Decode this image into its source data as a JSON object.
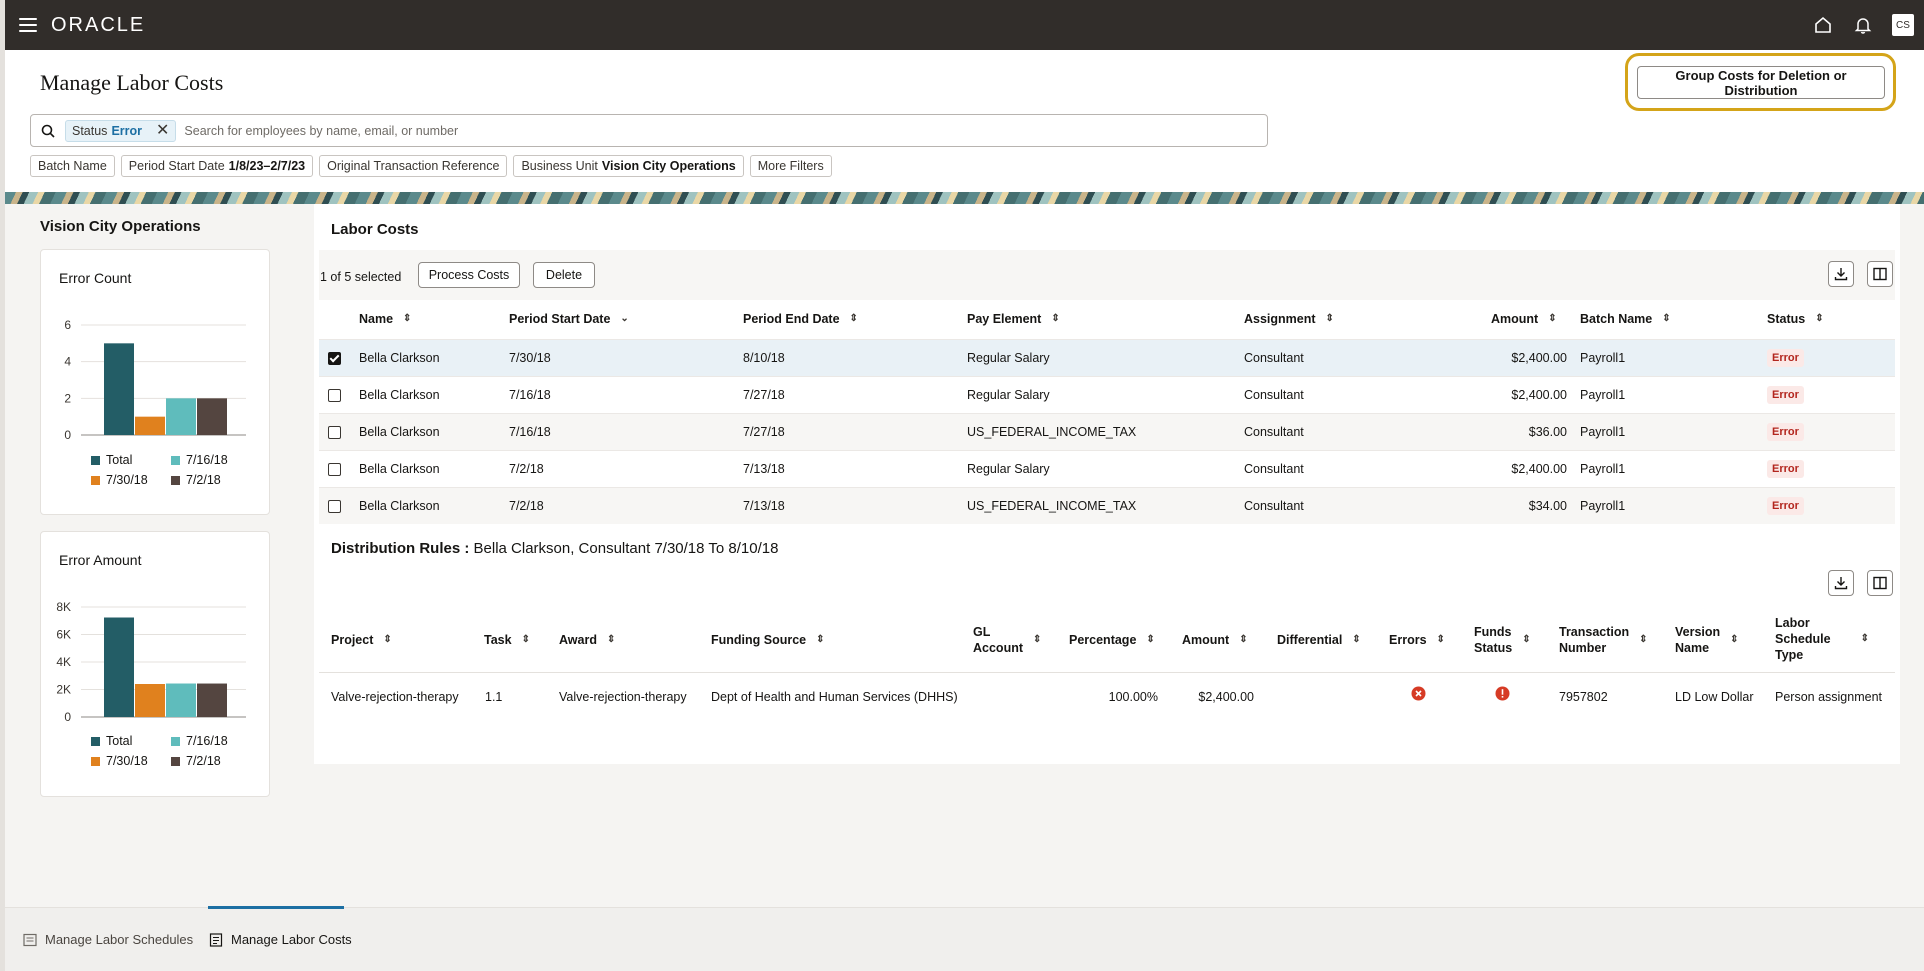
{
  "app": {
    "logo": "ORACLE",
    "avatar_initials": "CS"
  },
  "page": {
    "title": "Manage Labor Costs",
    "group_button": "Group Costs for Deletion or Distribution"
  },
  "search": {
    "chip_label": "Status",
    "chip_value": "Error",
    "placeholder": "Search for employees by name, email, or number"
  },
  "filters": [
    {
      "label": "Batch Name",
      "value": ""
    },
    {
      "label": "Period Start Date",
      "value": "1/8/23–2/7/23"
    },
    {
      "label": "Original Transaction Reference",
      "value": ""
    },
    {
      "label": "Business Unit",
      "value": "Vision City Operations"
    },
    {
      "label": "More Filters",
      "value": ""
    }
  ],
  "sidebar": {
    "title": "Vision City Operations",
    "error_count_title": "Error Count",
    "error_amount_title": "Error Amount"
  },
  "chart_data": [
    {
      "type": "bar",
      "title": "Error Count",
      "categories": [
        "Total",
        "7/30/18",
        "7/16/18",
        "7/2/18"
      ],
      "values": [
        5,
        1,
        2,
        2
      ],
      "ylim": [
        0,
        6
      ],
      "yticks": [
        "0",
        "2",
        "4",
        "6"
      ],
      "colors": [
        "#235d66",
        "#e0811e",
        "#5fbcbc",
        "#544540"
      ],
      "legend": [
        "Total",
        "7/16/18",
        "7/30/18",
        "7/2/18"
      ]
    },
    {
      "type": "bar",
      "title": "Error Amount",
      "categories": [
        "Total",
        "7/30/18",
        "7/16/18",
        "7/2/18"
      ],
      "values": [
        7236,
        2400,
        2436,
        2434
      ],
      "ylim": [
        0,
        8000
      ],
      "yticks": [
        "0",
        "2K",
        "4K",
        "6K",
        "8K"
      ],
      "colors": [
        "#235d66",
        "#e0811e",
        "#5fbcbc",
        "#544540"
      ],
      "legend": [
        "Total",
        "7/16/18",
        "7/30/18",
        "7/2/18"
      ]
    }
  ],
  "labor_costs": {
    "title": "Labor Costs",
    "selection": "1 of 5 selected",
    "process_button": "Process Costs",
    "delete_button": "Delete",
    "columns": {
      "name": "Name",
      "start": "Period Start Date",
      "end": "Period End Date",
      "element": "Pay Element",
      "assignment": "Assignment",
      "amount": "Amount",
      "batch": "Batch Name",
      "status": "Status"
    },
    "rows": [
      {
        "name": "Bella Clarkson",
        "start": "7/30/18",
        "end": "8/10/18",
        "element": "Regular Salary",
        "assignment": "Consultant",
        "amount": "$2,400.00",
        "batch": "Payroll1",
        "status": "Error",
        "checked": true
      },
      {
        "name": "Bella Clarkson",
        "start": "7/16/18",
        "end": "7/27/18",
        "element": "Regular Salary",
        "assignment": "Consultant",
        "amount": "$2,400.00",
        "batch": "Payroll1",
        "status": "Error",
        "checked": false
      },
      {
        "name": "Bella Clarkson",
        "start": "7/16/18",
        "end": "7/27/18",
        "element": "US_FEDERAL_INCOME_TAX",
        "assignment": "Consultant",
        "amount": "$36.00",
        "batch": "Payroll1",
        "status": "Error",
        "checked": false
      },
      {
        "name": "Bella Clarkson",
        "start": "7/2/18",
        "end": "7/13/18",
        "element": "Regular Salary",
        "assignment": "Consultant",
        "amount": "$2,400.00",
        "batch": "Payroll1",
        "status": "Error",
        "checked": false
      },
      {
        "name": "Bella Clarkson",
        "start": "7/2/18",
        "end": "7/13/18",
        "element": "US_FEDERAL_INCOME_TAX",
        "assignment": "Consultant",
        "amount": "$34.00",
        "batch": "Payroll1",
        "status": "Error",
        "checked": false
      }
    ]
  },
  "distribution": {
    "title_label": "Distribution Rules :",
    "title_value": "Bella Clarkson, Consultant 7/30/18 To 8/10/18",
    "columns": {
      "project": "Project",
      "task": "Task",
      "award": "Award",
      "funding": "Funding Source",
      "gl_1": "GL",
      "gl_2": "Account",
      "percentage": "Percentage",
      "amount": "Amount",
      "differential": "Differential",
      "errors": "Errors",
      "funds_1": "Funds",
      "funds_2": "Status",
      "txn_1": "Transaction",
      "txn_2": "Number",
      "version_1": "Version",
      "version_2": "Name",
      "lst_1": "Labor",
      "lst_2": "Schedule",
      "lst_3": "Type"
    },
    "row": {
      "project": "Valve-rejection-therapy",
      "task": "1.1",
      "award": "Valve-rejection-therapy",
      "funding": "Dept of Health and Human Services (DHHS)",
      "gl": "",
      "percentage": "100.00%",
      "amount": "$2,400.00",
      "differential": "",
      "transaction": "7957802",
      "version": "LD Low Dollar",
      "schedule_type": "Person assignment"
    }
  },
  "bottom_tabs": [
    {
      "label": "Manage Labor Schedules"
    },
    {
      "label": "Manage Labor Costs"
    }
  ]
}
